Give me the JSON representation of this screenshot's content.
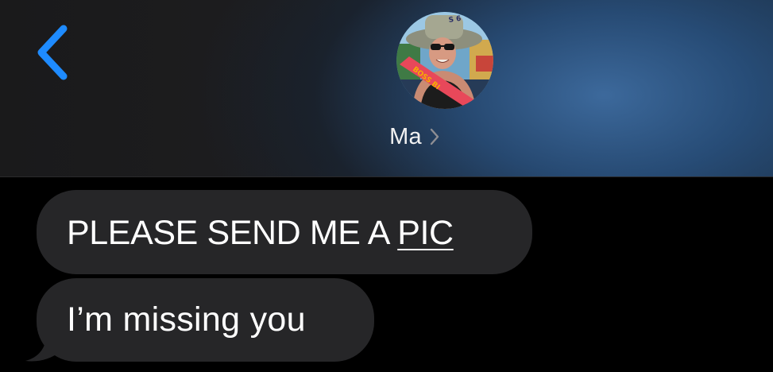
{
  "header": {
    "back_icon": "chevron-left-icon",
    "contact": {
      "name": "Ma",
      "avatar": "contact-photo",
      "avatar_hat_text": "S 6",
      "avatar_sash_text": "BOSS BI",
      "disclosure_icon": "chevron-right-icon"
    }
  },
  "messages": [
    {
      "direction": "incoming",
      "text_before_link": "PLEASE SEND ME A ",
      "link_text": "PIC"
    },
    {
      "direction": "incoming",
      "text": "I’m missing you"
    }
  ],
  "colors": {
    "accent": "#1e8bff",
    "bubble_incoming": "#262628",
    "background": "#000000",
    "header_blue": "#2c5684"
  }
}
